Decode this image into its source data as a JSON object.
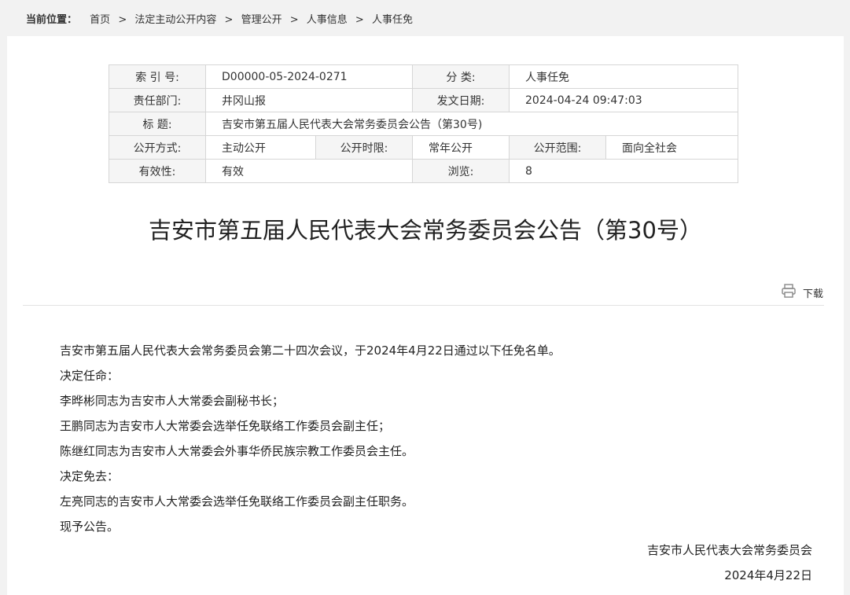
{
  "breadcrumb": {
    "label": "当前位置：",
    "items": [
      "首页",
      "法定主动公开内容",
      "管理公开",
      "人事信息",
      "人事任免"
    ],
    "separator": ">"
  },
  "meta": {
    "index_no_key": "索 引 号:",
    "index_no_val": "D00000-05-2024-0271",
    "category_key": "分 类:",
    "category_val": "人事任免",
    "dept_key": "责任部门:",
    "dept_val": "井冈山报",
    "date_key": "发文日期:",
    "date_val": "2024-04-24 09:47:03",
    "title_key": "标 题:",
    "title_val": "吉安市第五届人民代表大会常务委员会公告（第30号)",
    "mode_key": "公开方式:",
    "mode_val": "主动公开",
    "period_key": "公开时限:",
    "period_val": "常年公开",
    "scope_key": "公开范围:",
    "scope_val": "面向全社会",
    "valid_key": "有效性:",
    "valid_val": "有效",
    "views_key": "浏览:",
    "views_val": "8"
  },
  "article": {
    "title": "吉安市第五届人民代表大会常务委员会公告（第30号）",
    "download_label": "下载",
    "download_icon": "printer-icon",
    "paragraphs": [
      "吉安市第五届人民代表大会常务委员会第二十四次会议，于2024年4月22日通过以下任免名单。",
      "决定任命：",
      "李晔彬同志为吉安市人大常委会副秘书长；",
      "王鹏同志为吉安市人大常委会选举任免联络工作委员会副主任；",
      "陈继红同志为吉安市人大常委会外事华侨民族宗教工作委员会主任。",
      "决定免去：",
      "左亮同志的吉安市人大常委会选举任免联络工作委员会副主任职务。",
      "现予公告。"
    ],
    "signature": "吉安市人民代表大会常务委员会",
    "sign_date": "2024年4月22日"
  }
}
